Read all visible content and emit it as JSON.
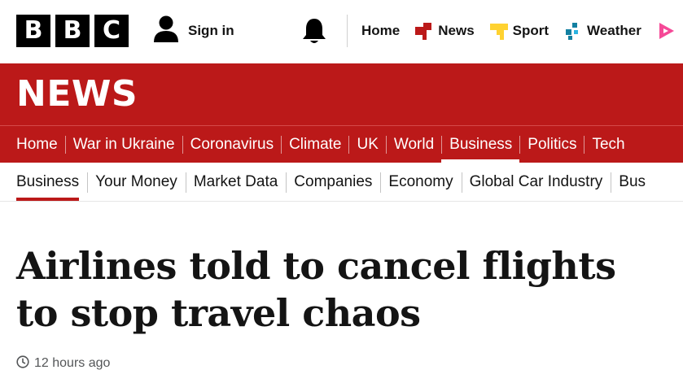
{
  "masthead": {
    "logo_letters": [
      "B",
      "B",
      "C"
    ],
    "signin_label": "Sign in",
    "nav": [
      {
        "label": "Home",
        "icon": "none"
      },
      {
        "label": "News",
        "icon": "news-icon",
        "color": "#bb1919"
      },
      {
        "label": "Sport",
        "icon": "sport-icon",
        "color": "#ffd230"
      },
      {
        "label": "Weather",
        "icon": "weather-icon",
        "color": "#1380a1"
      },
      {
        "label": "",
        "icon": "iplayer-icon",
        "color": "#f54997"
      }
    ]
  },
  "banner": {
    "title": "NEWS",
    "color": "#bb1919"
  },
  "sections": {
    "items": [
      "Home",
      "War in Ukraine",
      "Coronavirus",
      "Climate",
      "UK",
      "World",
      "Business",
      "Politics",
      "Tech"
    ],
    "active": "Business"
  },
  "subsections": {
    "items": [
      "Business",
      "Your Money",
      "Market Data",
      "Companies",
      "Economy",
      "Global Car Industry",
      "Bus"
    ],
    "active": "Business"
  },
  "article": {
    "headline": "Airlines told to cancel flights to stop travel chaos",
    "timestamp": "12 hours ago"
  }
}
